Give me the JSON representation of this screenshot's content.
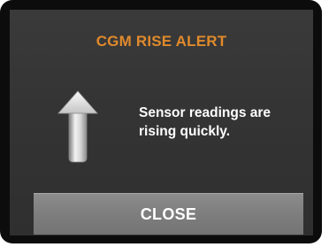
{
  "alert": {
    "title": "CGM RISE ALERT",
    "message_line1": "Sensor readings are",
    "message_line2": "rising quickly.",
    "icon": "up-arrow-icon"
  },
  "actions": {
    "close_label": "CLOSE"
  },
  "colors": {
    "title": "#e08a2c",
    "screen_background": "#363636",
    "button_background": "#808080",
    "text": "#ffffff"
  }
}
